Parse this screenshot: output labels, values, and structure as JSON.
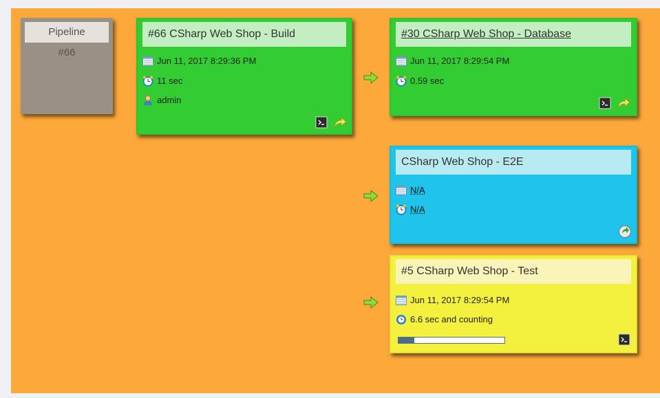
{
  "pipeline": {
    "title": "Pipeline",
    "number": "#66"
  },
  "cards": {
    "build": {
      "title": "#66 CSharp Web Shop - Build",
      "date": "Jun 11, 2017 8:29:36 PM",
      "duration": "11 sec",
      "user": "admin",
      "status_color": "#33cc33"
    },
    "database": {
      "title": "#30 CSharp Web Shop - Database",
      "date": "Jun 11, 2017 8:29:54 PM",
      "duration": "0.59 sec",
      "status_color": "#33cc33"
    },
    "e2e": {
      "title": "CSharp Web Shop - E2E",
      "date": "N/A",
      "duration": "N/A",
      "status_color": "#1ec4ea"
    },
    "test": {
      "title": "#5 CSharp Web Shop - Test",
      "date": "Jun 11, 2017 8:29:54 PM",
      "duration": "6.6 sec and counting",
      "progress": 0.15,
      "status_color": "#f4f03e"
    }
  },
  "icons": {
    "calendar": "calendar-icon",
    "clock": "clock-icon",
    "user": "user-icon",
    "console": "console-icon",
    "rebuild": "rebuild-arrow-icon",
    "trigger": "trigger-build-icon",
    "flow": "green-arrow-icon"
  },
  "colors": {
    "background": "#fca83a",
    "pipeline": "#9b9084"
  }
}
